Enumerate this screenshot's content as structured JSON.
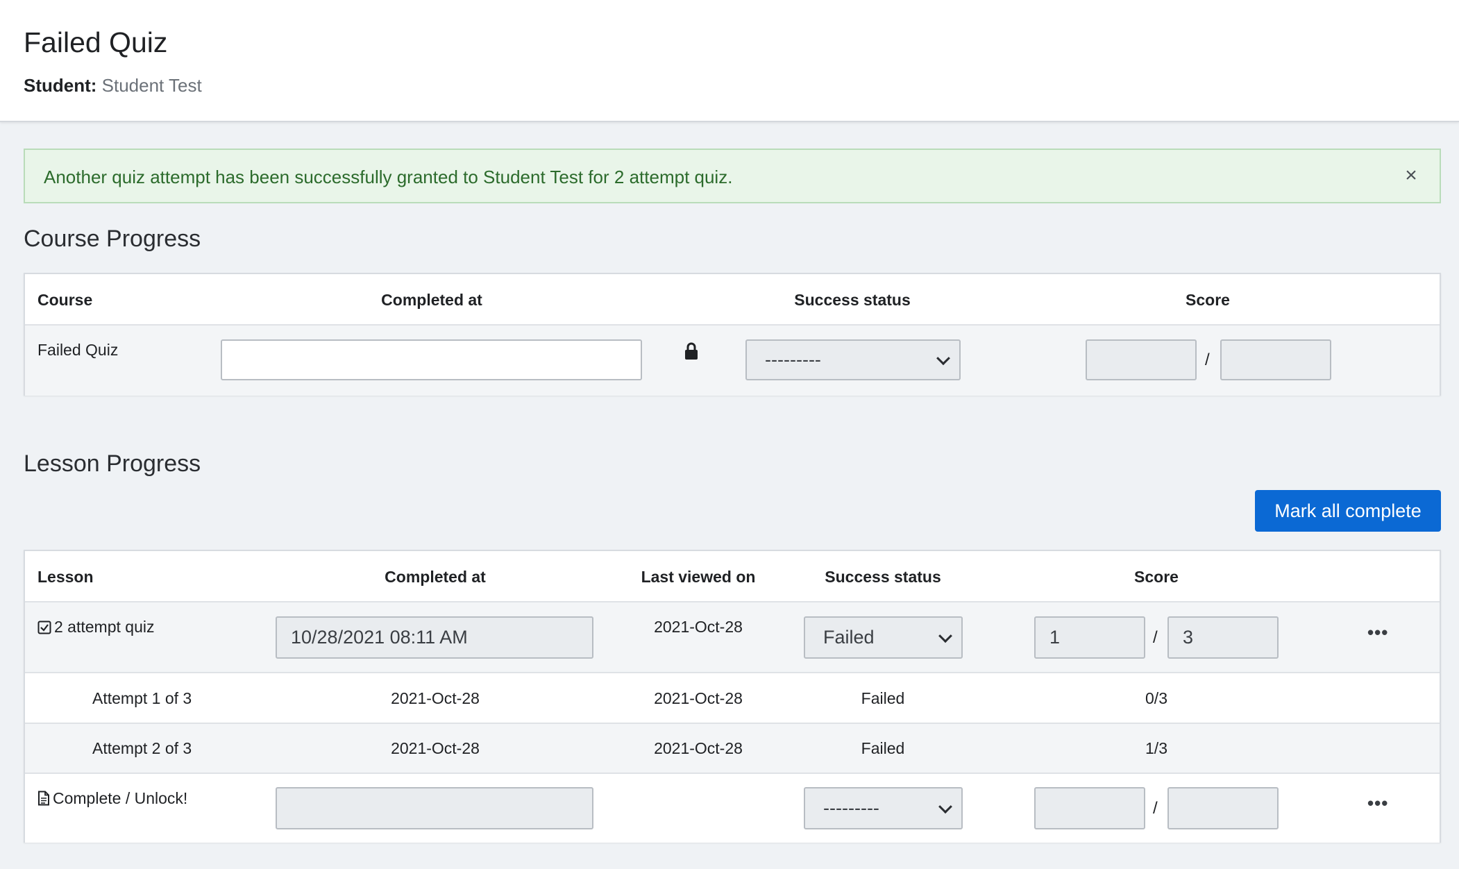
{
  "header": {
    "title": "Failed Quiz",
    "student_label": "Student:",
    "student_name": "Student Test"
  },
  "alert": {
    "message": "Another quiz attempt has been successfully granted to Student Test for 2 attempt quiz.",
    "close_glyph": "×"
  },
  "course_progress": {
    "title": "Course Progress",
    "columns": [
      "Course",
      "Completed at",
      "Success status",
      "Score"
    ],
    "row": {
      "course": "Failed Quiz",
      "completed_at": "",
      "success_status": "---------",
      "score": "",
      "max_score": "",
      "locked": true
    }
  },
  "lesson_progress": {
    "title": "Lesson Progress",
    "mark_all_label": "Mark all complete",
    "columns": [
      "Lesson",
      "Completed at",
      "Last viewed on",
      "Success status",
      "Score"
    ],
    "rows": [
      {
        "icon": "checkbox-icon",
        "lesson": "2 attempt quiz",
        "completed_at": "10/28/2021 08:11 AM",
        "last_viewed": "2021-Oct-28",
        "success_status": "Failed",
        "score": "1",
        "max_score": "3"
      },
      {
        "icon": "document-icon",
        "lesson": "Complete / Unlock!",
        "completed_at": "",
        "last_viewed": "",
        "success_status": "---------",
        "score": "",
        "max_score": ""
      }
    ],
    "attempts": [
      {
        "label": "Attempt 1 of 3",
        "completed_at": "2021-Oct-28",
        "last_viewed": "2021-Oct-28",
        "status": "Failed",
        "score": "0/3"
      },
      {
        "label": "Attempt 2 of 3",
        "completed_at": "2021-Oct-28",
        "last_viewed": "2021-Oct-28",
        "status": "Failed",
        "score": "1/3"
      }
    ],
    "slash": "/",
    "more_glyph": "•••"
  },
  "colors": {
    "page_bg": "#eff2f5",
    "alert_bg": "#e9f5e9",
    "alert_text": "#2c6b2c",
    "primary": "#0b69d4"
  }
}
